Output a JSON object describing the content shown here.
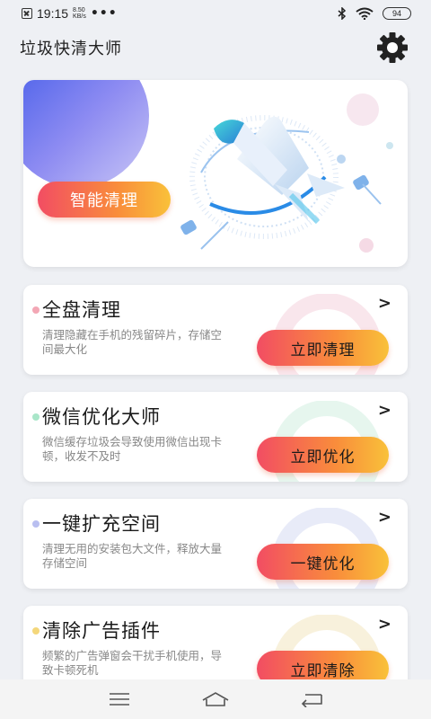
{
  "status_bar": {
    "time": "19:15",
    "net_speed_value": "8.50",
    "net_speed_unit": "KB/s",
    "more": "•••",
    "battery": "94"
  },
  "header": {
    "title": "垃圾快清大师"
  },
  "hero": {
    "button_label": "智能清理"
  },
  "cards": [
    {
      "title": "全盘清理",
      "desc": "清理隐藏在手机的残留碎片，存储空间最大化",
      "button": "立即清理",
      "chevron": ">",
      "accent": "#f3a7b5"
    },
    {
      "title": "微信优化大师",
      "desc": "微信缓存垃圾会导致使用微信出现卡顿，收发不及时",
      "button": "立即优化",
      "chevron": ">",
      "accent": "#a9e6c9"
    },
    {
      "title": "一键扩充空间",
      "desc": "清理无用的安装包大文件，释放大量存储空间",
      "button": "一键优化",
      "chevron": ">",
      "accent": "#b9bff0"
    },
    {
      "title": "清除广告插件",
      "desc": "频繁的广告弹窗会干扰手机使用，导致卡顿死机",
      "button": "立即清除",
      "chevron": ">",
      "accent": "#f4d77b"
    }
  ],
  "icons": {
    "settings": "gear-icon",
    "nav_menu": "menu-icon",
    "nav_home": "home-icon",
    "nav_back": "back-icon"
  },
  "colors": {
    "button_gradient_start": "#f24d63",
    "button_gradient_end": "#f9c13a",
    "hero_blob": "#3d58e8"
  }
}
